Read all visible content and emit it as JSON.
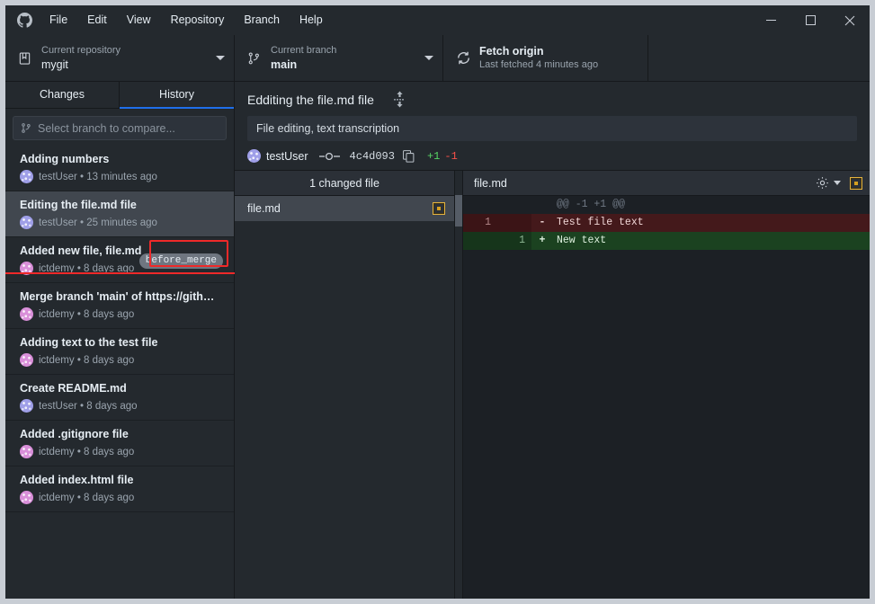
{
  "window": {
    "app_name": "GitHub Desktop",
    "minimize_label": "–",
    "maximize_label": "□",
    "close_label": "✕"
  },
  "menubar": {
    "items": [
      {
        "label": "File"
      },
      {
        "label": "Edit"
      },
      {
        "label": "View"
      },
      {
        "label": "Repository"
      },
      {
        "label": "Branch"
      },
      {
        "label": "Help"
      }
    ]
  },
  "toolbar": {
    "repository": {
      "label": "Current repository",
      "value": "mygit"
    },
    "branch": {
      "label": "Current branch",
      "value": "main"
    },
    "fetch": {
      "title": "Fetch origin",
      "subtitle": "Last fetched 4 minutes ago"
    }
  },
  "sidebar": {
    "tabs": [
      {
        "label": "Changes",
        "active": false
      },
      {
        "label": "History",
        "active": true
      }
    ],
    "compare_placeholder": "Select branch to compare...",
    "commits": [
      {
        "title": "Adding numbers",
        "author": "testUser",
        "time": "13 minutes ago",
        "avatar": "v1",
        "selected": false,
        "tag": ""
      },
      {
        "title": "Editing the file.md file",
        "author": "testUser",
        "time": "25 minutes ago",
        "avatar": "v1",
        "selected": true,
        "tag": ""
      },
      {
        "title": "Added new file, file.md",
        "author": "ictdemy",
        "time": "8 days ago",
        "avatar": "v2",
        "selected": false,
        "tag": "before_merge"
      },
      {
        "title": "Merge branch 'main' of https://github....",
        "author": "ictdemy",
        "time": "8 days ago",
        "avatar": "v2",
        "selected": false,
        "tag": ""
      },
      {
        "title": "Adding text to the test file",
        "author": "ictdemy",
        "time": "8 days ago",
        "avatar": "v2",
        "selected": false,
        "tag": ""
      },
      {
        "title": "Create README.md",
        "author": "testUser",
        "time": "8 days ago",
        "avatar": "v1",
        "selected": false,
        "tag": ""
      },
      {
        "title": "Added .gitignore file",
        "author": "ictdemy",
        "time": "8 days ago",
        "avatar": "v2",
        "selected": false,
        "tag": ""
      },
      {
        "title": "Added index.html file",
        "author": "ictdemy",
        "time": "8 days ago",
        "avatar": "v2",
        "selected": false,
        "tag": ""
      }
    ]
  },
  "commit_detail": {
    "title": "Edditing the file.md file",
    "description": "File editing, text transcription",
    "author": "testUser",
    "sha": "4c4d093",
    "additions": "+1",
    "deletions": "-1"
  },
  "changed_files": {
    "header": "1 changed file",
    "files": [
      {
        "name": "file.md",
        "status": "modified"
      }
    ]
  },
  "diff": {
    "filename": "file.md",
    "lines": [
      {
        "kind": "hunk",
        "old": "",
        "new": "",
        "sign": "",
        "text": "@@ -1 +1 @@"
      },
      {
        "kind": "del",
        "old": "1",
        "new": "",
        "sign": "-",
        "text": "Test file text"
      },
      {
        "kind": "add",
        "old": "",
        "new": "1",
        "sign": "+",
        "text": "New text"
      }
    ]
  },
  "colors": {
    "accent_blue": "#1f6feb",
    "addition_green": "#56d364",
    "deletion_red": "#f85149",
    "annotation_red": "#ef2929",
    "status_yellow": "#d6a020",
    "window_bg": "#24292e"
  }
}
